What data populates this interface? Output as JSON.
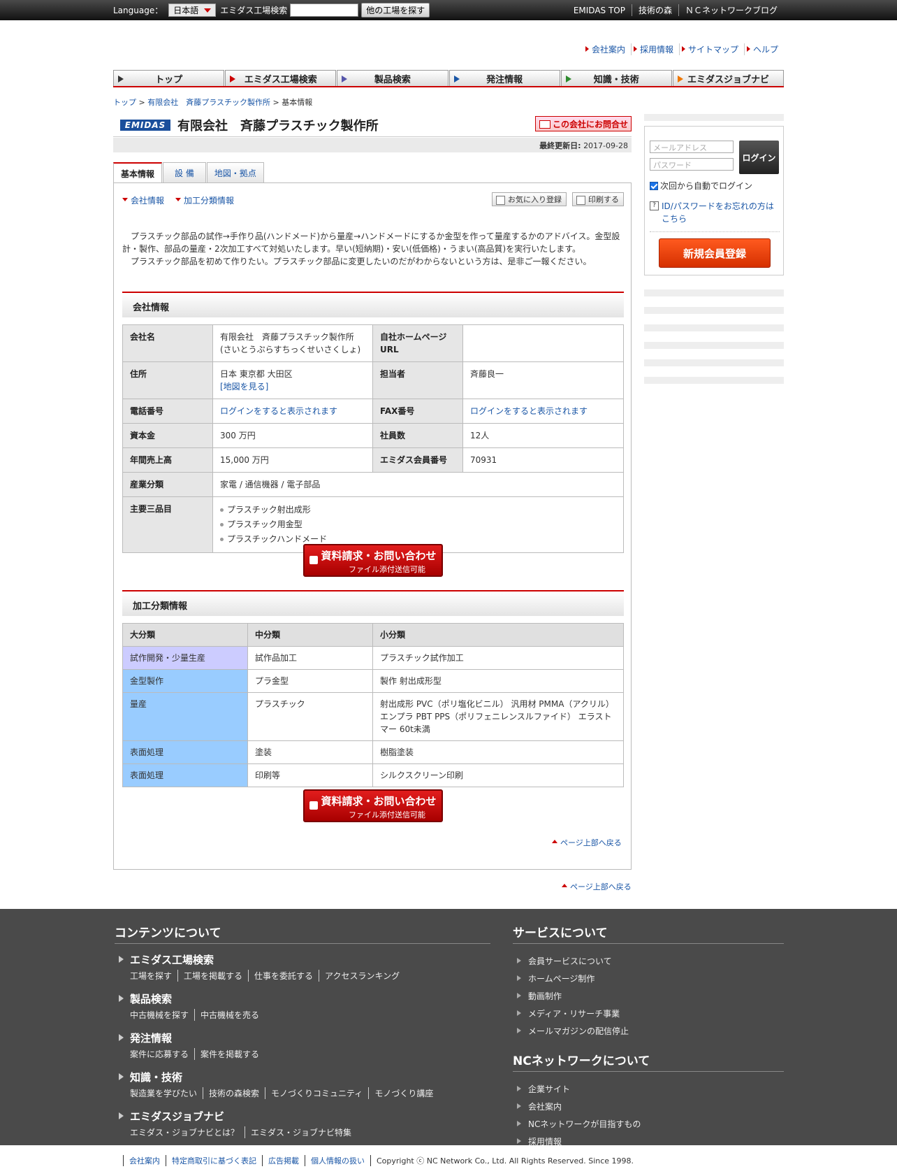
{
  "topbar": {
    "language_label": "Language：",
    "language_value": "日本語",
    "search_label": "エミダス工場検索",
    "search_placeholder": "",
    "search_button": "他の工場を探す",
    "links": [
      "EMIDAS TOP",
      "技術の森",
      "ＮＣネットワークブログ"
    ]
  },
  "util_links": [
    "会社案内",
    "採用情報",
    "サイトマップ",
    "ヘルプ"
  ],
  "gnav": [
    {
      "label": "トップ",
      "color": "#333333"
    },
    {
      "label": "エミダス工場検索",
      "color": "#cc0000"
    },
    {
      "label": "製品検索",
      "color": "#5555aa"
    },
    {
      "label": "発注情報",
      "color": "#1a56a6"
    },
    {
      "label": "知識・技術",
      "color": "#2e8b2e"
    },
    {
      "label": "エミダスジョブナビ",
      "color": "#ee7700"
    }
  ],
  "breadcrumb": {
    "top": "トップ",
    "company": "有限会社　斉藤プラスチック製作所",
    "current": "基本情報",
    "sep": " > "
  },
  "company": {
    "logo_text": "EMIDAS",
    "name": "有限会社　斉藤プラスチック製作所",
    "inquiry_button": "この会社にお問合せ",
    "updated_label": "最終更新日:",
    "updated_value": "2017-09-28"
  },
  "tabs": [
    "基本情報",
    "設 備",
    "地図・拠点"
  ],
  "anchors": [
    "会社情報",
    "加工分類情報"
  ],
  "tools": [
    "お気に入り登録",
    "印刷する"
  ],
  "intro": [
    "　プラスチック部品の試作→手作り品(ハンドメード)から量産→ハンドメードにするか金型を作って量産するかのアドバイス。金型設計・製作、部品の量産・2次加工すべて対処いたします。早い(短納期)・安い(低価格)・うまい(高品質)を実行いたします。",
    "　プラスチック部品を初めて作りたい。プラスチック部品に変更したいのだがわからないという方は、是非ご一報ください。"
  ],
  "info_section": {
    "heading": "会社情報",
    "company_name_label": "会社名",
    "company_name": "有限会社　斉藤プラスチック製作所",
    "company_kana": "(さいとうぷらすちっくせいさくしょ)",
    "homepage_label": "自社ホームページURL",
    "homepage_value": "",
    "address_label": "住所",
    "address": "日本 東京都 大田区",
    "map_link": "[地図を見る]",
    "contact_label": "担当者",
    "contact": "斉藤良一",
    "phone_label": "電話番号",
    "phone": "ログインをすると表示されます",
    "fax_label": "FAX番号",
    "fax": "ログインをすると表示されます",
    "capital_label": "資本金",
    "capital": "300 万円",
    "employees_label": "社員数",
    "employees": "12人",
    "sales_label": "年間売上高",
    "sales": "15,000 万円",
    "member_label": "エミダス会員番号",
    "member": "70931",
    "industry_label": "産業分類",
    "industry": "家電 / 通信機器 / 電子部品",
    "products_label": "主要三品目",
    "products": [
      "プラスチック射出成形",
      "プラスチック用金型",
      "プラスチックハンドメード"
    ]
  },
  "request_button": {
    "line1": "資料請求・お問い合わせ",
    "line2": "ファイル添付送信可能"
  },
  "class_section": {
    "heading": "加工分類情報",
    "headers": [
      "大分類",
      "中分類",
      "小分類"
    ],
    "rows": [
      {
        "major": "試作開発・少量生産",
        "middle": "試作品加工",
        "minor": "プラスチック試作加工",
        "color": "#ccccff"
      },
      {
        "major": "金型製作",
        "middle": "プラ金型",
        "minor": "製作 射出成形型",
        "color": "#99ccff"
      },
      {
        "major": "量産",
        "middle": "プラスチック",
        "minor": "射出成形 PVC（ポリ塩化ビニル） 汎用材 PMMA（アクリル） エンプラ PBT PPS（ポリフェニレンスルファイド） エラストマー 60t未満",
        "color": "#99ccff"
      },
      {
        "major": "表面処理",
        "middle": "塗装",
        "minor": "樹脂塗装",
        "color": "#99ccff"
      },
      {
        "major": "表面処理",
        "middle": "印刷等",
        "minor": "シルクスクリーン印刷",
        "color": "#99ccff"
      }
    ]
  },
  "page_top": "ページ上部へ戻る",
  "login": {
    "email_placeholder": "メールアドレス",
    "password_placeholder": "パスワード",
    "login_button": "ログイン",
    "auto_login": "次回から自動でログイン",
    "forgot": "ID/パスワードをお忘れの方はこちら",
    "register_button": "新規会員登録"
  },
  "footer": {
    "contents_heading": "コンテンツについて",
    "sections": [
      {
        "title": "エミダス工場検索",
        "links": [
          "工場を探す",
          "工場を掲載する",
          "仕事を委託する",
          "アクセスランキング"
        ]
      },
      {
        "title": "製品検索",
        "links": [
          "中古機械を探す",
          "中古機械を売る"
        ]
      },
      {
        "title": "発注情報",
        "links": [
          "案件に応募する",
          "案件を掲載する"
        ]
      },
      {
        "title": "知識・技術",
        "links": [
          "製造業を学びたい",
          "技術の森検索",
          "モノづくりコミュニティ",
          "モノづくり講座"
        ]
      },
      {
        "title": "エミダスジョブナビ",
        "links": [
          "エミダス・ジョブナビとは？",
          "エミダス・ジョブナビ特集"
        ]
      }
    ],
    "service_heading": "サービスについて",
    "service_links": [
      "会員サービスについて",
      "ホームページ制作",
      "動画制作",
      "メディア・リサーチ事業",
      "メールマガジンの配信停止"
    ],
    "nc_heading": "NCネットワークについて",
    "nc_links": [
      "企業サイト",
      "会社案内",
      "NCネットワークが目指すもの",
      "採用情報"
    ]
  },
  "bottom": {
    "links": [
      "会社案内",
      "特定商取引に基づく表記",
      "広告掲載",
      "個人情報の扱い"
    ],
    "copyright": "Copyright ⓒ NC Network Co., Ltd. All Rights Reserved. Since 1998."
  }
}
